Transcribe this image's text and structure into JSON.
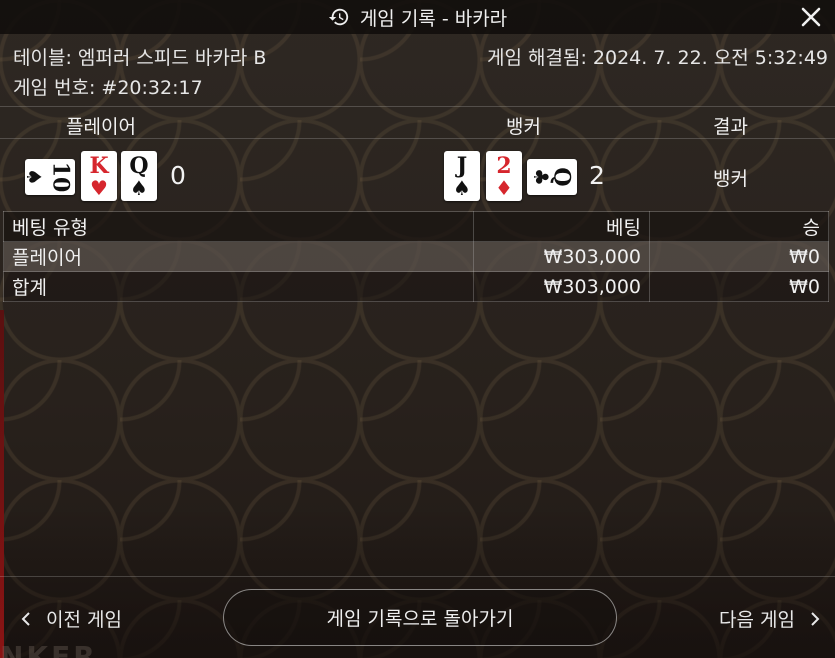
{
  "header": {
    "title": "게임 기록 - 바카라",
    "icon": "history-icon",
    "close_icon": "close-icon"
  },
  "info": {
    "table": "테이블: 엠퍼러 스피드 바카라 B",
    "game_number": "게임 번호: #20:32:17",
    "resolved": "게임 해결됨: 2024. 7. 22. 오전 5:32:49"
  },
  "columns": {
    "player": "플레이어",
    "banker": "뱅커",
    "result": "결과"
  },
  "player": {
    "cards": [
      {
        "rank": "10",
        "suit": "♠",
        "color": "black",
        "side": true
      },
      {
        "rank": "K",
        "suit": "♥",
        "color": "red",
        "side": false
      },
      {
        "rank": "Q",
        "suit": "♠",
        "color": "black",
        "side": false
      }
    ],
    "score": "0"
  },
  "banker": {
    "cards": [
      {
        "rank": "J",
        "suit": "♠",
        "color": "black",
        "side": false
      },
      {
        "rank": "2",
        "suit": "♦",
        "color": "red",
        "side": false
      },
      {
        "rank": "Q",
        "suit": "♣",
        "color": "black",
        "side": true
      }
    ],
    "score": "2"
  },
  "result": "뱅커",
  "bets": {
    "headers": {
      "type": "베팅 유형",
      "bet": "베팅",
      "win": "승"
    },
    "rows": [
      {
        "type": "플레이어",
        "bet": "₩303,000",
        "win": "₩0"
      }
    ],
    "total": {
      "type": "합계",
      "bet": "₩303,000",
      "win": "₩0"
    }
  },
  "footer": {
    "prev": "이전 게임",
    "back": "게임 기록으로 돌아가기",
    "next": "다음 게임"
  },
  "background_text": "NKER"
}
